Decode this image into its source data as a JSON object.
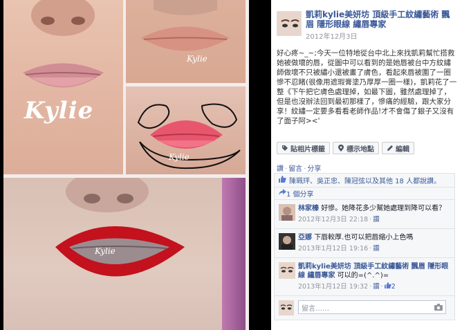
{
  "post": {
    "page_name": "凱莉kylie美妍坊 頂級手工紋繡藝術 飄眉 隱形眼線 繡唇專家",
    "date": "2012年12月3日",
    "body": "好心疼~_~;今天一位特地從台中北上來找凱莉幫忙搭救她被做壞的唇，從圖中可以看到的是她唇被台中方紋繡師做壞不只被繡小還被畫了膚色，看起來唇被圍了一圈慘不忍睹(很像用遮瑕膏塗乃厚厚一圈一樣)，凱莉花了一整《下午把它膚色處理掉，如最下圖，雖然處理掉了，但是也沒辦法回到最初那樣了，慘痛的經驗，跟大家分享！紋繡一定要多看看老師作品!才不會傷了銀子又沒有了面子阿><'"
  },
  "photo": {
    "watermark_big": "Kylie",
    "watermark_small": "Kylie"
  },
  "actions": {
    "tag": "貼相片標籤",
    "location": "標示地點",
    "edit": "編輯"
  },
  "links": {
    "like": "讚",
    "comment": "留言",
    "share": "分享"
  },
  "ufi": {
    "likes_text": "陳珮玶、吳正忠、陳冠弦以及其他 18 人都說讚。",
    "shares_text": "1 個分享",
    "comments": [
      {
        "name": "林家榛",
        "text": "好慘。她降花多少幫她處理到降可以看？",
        "time": "2012年12月3日 22:18",
        "like": "讚"
      },
      {
        "name": "亞娜",
        "text": "下唇較厚.也可以把唇縮小上色嗎",
        "time": "2013年1月12日 19:16",
        "like": "讚"
      },
      {
        "name": "凱莉kylie美妍坊 頂級手工紋繡藝術 飄眉 隱形眼線 繡唇專家",
        "text": "可以的=(^.^)=",
        "time": "2013年1月12日 19:32",
        "like": "讚",
        "like_count": "2"
      }
    ],
    "composer_placeholder": "留言……"
  },
  "colors": {
    "link": "#3b5998",
    "meta": "#90949c"
  },
  "icons": {
    "tag": "tag-icon",
    "location": "location-icon",
    "edit": "pencil-icon",
    "like": "thumbs-up-icon",
    "share": "share-icon",
    "camera": "camera-icon"
  }
}
